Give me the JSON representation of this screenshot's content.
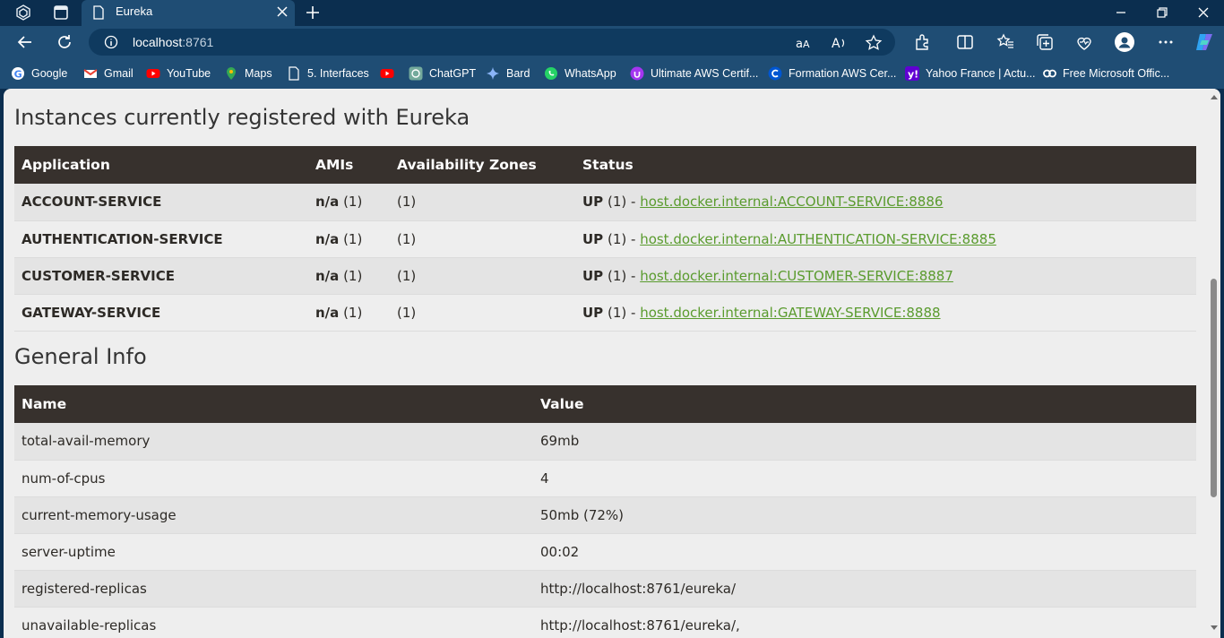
{
  "browser": {
    "tab_title": "Eureka",
    "url_host": "localhost",
    "url_port": ":8761"
  },
  "bookmarks": [
    {
      "label": "Google",
      "icon": "google-icon"
    },
    {
      "label": "Gmail",
      "icon": "gmail-icon"
    },
    {
      "label": "YouTube",
      "icon": "youtube-icon"
    },
    {
      "label": "Maps",
      "icon": "maps-icon"
    },
    {
      "label": "5. Interfaces",
      "icon": "page-icon"
    },
    {
      "label": "",
      "icon": "youtube-icon"
    },
    {
      "label": "ChatGPT",
      "icon": "chatgpt-icon"
    },
    {
      "label": "Bard",
      "icon": "bard-icon"
    },
    {
      "label": "WhatsApp",
      "icon": "whatsapp-icon"
    },
    {
      "label": "Ultimate AWS Certif...",
      "icon": "udemy-icon"
    },
    {
      "label": "Formation AWS Cer...",
      "icon": "coursera-icon"
    },
    {
      "label": "Yahoo France | Actu...",
      "icon": "yahoo-icon"
    },
    {
      "label": "Free Microsoft Offic...",
      "icon": "coursera-co-icon"
    }
  ],
  "instances": {
    "heading": "Instances currently registered with Eureka",
    "headers": [
      "Application",
      "AMIs",
      "Availability Zones",
      "Status"
    ],
    "rows": [
      {
        "app": "ACCOUNT-SERVICE",
        "ami": "n/a",
        "ami_count": "(1)",
        "zones": "(1)",
        "status": "UP",
        "status_count": "(1) -",
        "link": "host.docker.internal:ACCOUNT-SERVICE:8886"
      },
      {
        "app": "AUTHENTICATION-SERVICE",
        "ami": "n/a",
        "ami_count": "(1)",
        "zones": "(1)",
        "status": "UP",
        "status_count": "(1) -",
        "link": "host.docker.internal:AUTHENTICATION-SERVICE:8885"
      },
      {
        "app": "CUSTOMER-SERVICE",
        "ami": "n/a",
        "ami_count": "(1)",
        "zones": "(1)",
        "status": "UP",
        "status_count": "(1) -",
        "link": "host.docker.internal:CUSTOMER-SERVICE:8887"
      },
      {
        "app": "GATEWAY-SERVICE",
        "ami": "n/a",
        "ami_count": "(1)",
        "zones": "(1)",
        "status": "UP",
        "status_count": "(1) -",
        "link": "host.docker.internal:GATEWAY-SERVICE:8888"
      }
    ]
  },
  "general_info": {
    "heading": "General Info",
    "headers": [
      "Name",
      "Value"
    ],
    "rows": [
      {
        "name": "total-avail-memory",
        "value": "69mb"
      },
      {
        "name": "num-of-cpus",
        "value": "4"
      },
      {
        "name": "current-memory-usage",
        "value": "50mb (72%)"
      },
      {
        "name": "server-uptime",
        "value": "00:02"
      },
      {
        "name": "registered-replicas",
        "value": "http://localhost:8761/eureka/"
      },
      {
        "name": "unavailable-replicas",
        "value": "http://localhost:8761/eureka/,"
      }
    ]
  },
  "colors": {
    "chrome_dark": "#0b2e4f",
    "chrome": "#1f4d74",
    "table_header": "#37312d",
    "link": "#5a9b2e"
  }
}
